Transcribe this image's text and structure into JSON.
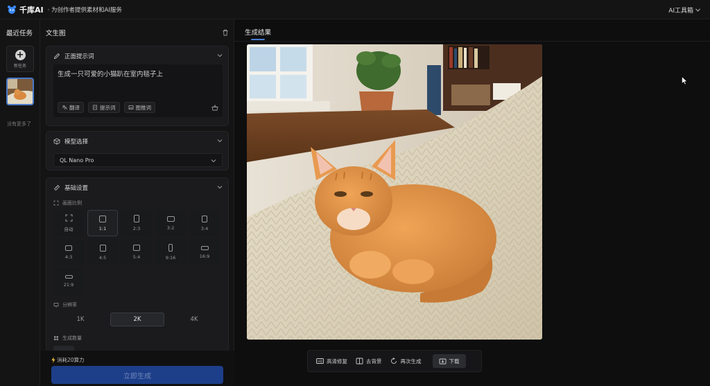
{
  "header": {
    "logo_text": "千库AI",
    "slogan": "· 为创作者提供素材和AI服务",
    "toolbox": "AI工具箱"
  },
  "sidebar": {
    "title": "最近任务",
    "new_task": "新任务",
    "no_more": "没有更多了"
  },
  "panel": {
    "title": "文生图",
    "prompt": {
      "title": "正面提示词",
      "value": "生成一只可爱的小猫趴在室内毯子上",
      "tools": [
        "翻译",
        "提示词",
        "图推词"
      ]
    },
    "model": {
      "title": "模型选择",
      "selected": "QL Nano Pro"
    },
    "basic": {
      "title": "基础设置",
      "ratio_label": "画面比例",
      "ratios": [
        "自动",
        "1:1",
        "2:3",
        "3:2",
        "3:4",
        "4:3",
        "4:5",
        "5:4",
        "9:16",
        "16:9",
        "21:9"
      ],
      "selected_ratio": "1:1",
      "resolution_label": "分辨率",
      "resolutions": [
        "1K",
        "2K",
        "4K"
      ],
      "selected_resolution": "2K",
      "count_label": "生成数量"
    },
    "footer": {
      "cost": "消耗20算力",
      "generate": "立即生成"
    }
  },
  "result": {
    "tab": "生成结果",
    "actions": [
      "高清修复",
      "去背景",
      "再次生成",
      "下载"
    ]
  },
  "colors": {
    "accent": "#4a7fd8",
    "generate_button": "#1d3f8a",
    "background": "#0f0f10",
    "panel": "#141415"
  }
}
